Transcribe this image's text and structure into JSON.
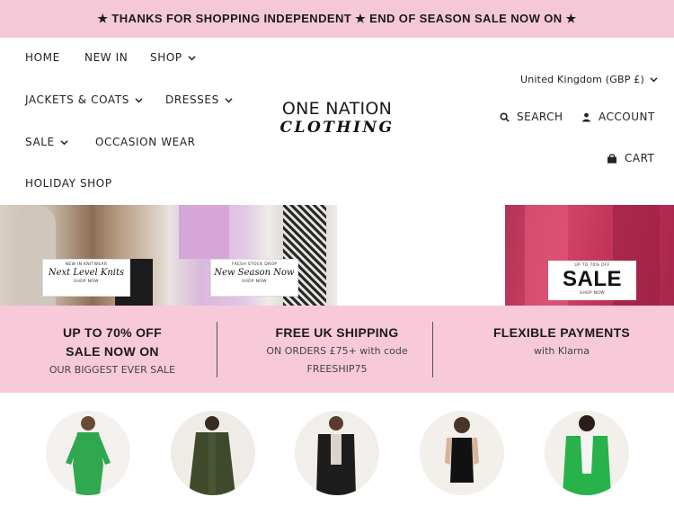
{
  "announcement": "★ THANKS FOR SHOPPING INDEPENDENT ★ END OF SEASON SALE NOW ON ★",
  "nav": {
    "home": "HOME",
    "new_in": "NEW IN",
    "shop": "SHOP",
    "jackets_coats": "JACKETS & COATS",
    "dresses": "DRESSES",
    "sale": "SALE",
    "occasion_wear": "OCCASION WEAR",
    "holiday_shop": "HOLIDAY SHOP"
  },
  "logo": {
    "line1": "ONE NATION",
    "line2": "CLOTHING"
  },
  "utility": {
    "currency": "United Kingdom (GBP £)",
    "search": "SEARCH",
    "account": "ACCOUNT",
    "cart": "CART"
  },
  "banners": {
    "knits": {
      "kicker": "NEW IN KNITWEAR",
      "script": "Next Level Knits",
      "cta": "SHOP NOW"
    },
    "new_season": {
      "kicker": "FRESH STOCK DROP",
      "script": "New Season Now",
      "cta": "SHOP NOW"
    },
    "sale": {
      "kicker": "UP TO 70% OFF",
      "title": "SALE",
      "cta": "SHOP NOW"
    }
  },
  "features": [
    {
      "title": "UP TO 70% OFF SALE NOW ON",
      "subtitle": "OUR BIGGEST EVER SALE"
    },
    {
      "title": "FREE UK SHIPPING",
      "subtitle": "ON ORDERS £75+ with code FREESHIP75"
    },
    {
      "title": "FLEXIBLE PAYMENTS",
      "subtitle": "with Klarna"
    }
  ],
  "colors": {
    "announcement_bg": "#f5c8d8",
    "features_bg": "#f7c9d9",
    "sale_banner": "#c2335a",
    "text": "#222222"
  },
  "icons": {
    "search": "search-icon",
    "account": "user-icon",
    "cart": "shopping-bag-icon",
    "dropdown": "chevron-down-icon"
  }
}
